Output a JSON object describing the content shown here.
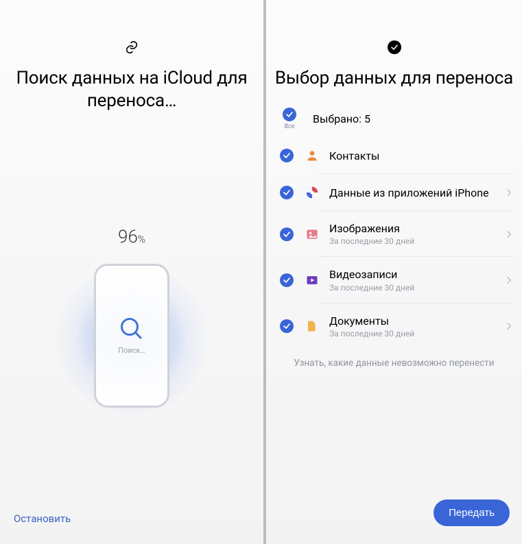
{
  "left": {
    "title": "Поиск данных на iCloud для переноса…",
    "progress_value": "96",
    "progress_pct": "%",
    "searching_label": "Поиск…",
    "stop_label": "Остановить"
  },
  "right": {
    "title": "Выбор данных для переноса",
    "all_label": "Все",
    "selected_label": "Выбрано: 5",
    "items": [
      {
        "title": "Контакты",
        "sub": ""
      },
      {
        "title": "Данные из приложений iPhone",
        "sub": ""
      },
      {
        "title": "Изображения",
        "sub": "За последние 30 дней"
      },
      {
        "title": "Видеозаписи",
        "sub": "За последние 30 дней"
      },
      {
        "title": "Документы",
        "sub": "За последние 30 дней"
      }
    ],
    "cannot_transfer": "Узнать, какие данные невозможно перенести",
    "transfer_label": "Передать"
  }
}
